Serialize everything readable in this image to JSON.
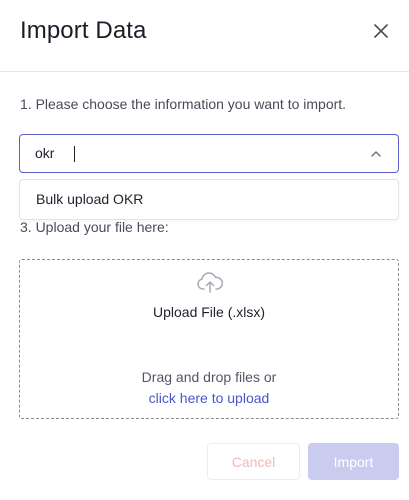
{
  "dialog": {
    "title": "Import Data"
  },
  "step1": {
    "label": "1. Please choose the information you want to import."
  },
  "select": {
    "value": "okr"
  },
  "dropdown": {
    "options": [
      "Bulk upload OKR"
    ]
  },
  "step3": {
    "label": "3. Upload your file here:"
  },
  "upload": {
    "label": "Upload File (.xlsx)",
    "drag_text": "Drag and drop files or",
    "link_text": "click here to upload",
    "link_color": "#4a55c8"
  },
  "footer": {
    "cancel_label": "Cancel",
    "import_label": "Import"
  },
  "colors": {
    "accent": "#5b5fc7",
    "import_disabled": "#c9cbef",
    "cancel_disabled_text": "#f0b9b9"
  },
  "icons": {
    "close": "close-icon",
    "chevron": "chevron-up-icon",
    "upload": "cloud-upload-icon"
  }
}
